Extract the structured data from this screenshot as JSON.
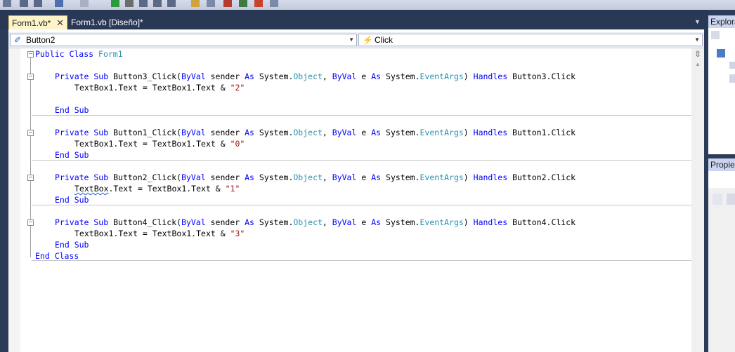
{
  "tabs": {
    "active": "Form1.vb*",
    "active_close": "✕",
    "second": "Form1.vb [Diseño]*",
    "dropdown": "▼"
  },
  "nav": {
    "object": "Button2",
    "event": "Click",
    "arrow": "▼"
  },
  "code": {
    "class_open": {
      "kw": "Public Class",
      "name": "Form1"
    },
    "class_close": "End Class",
    "sub_prefix": "Private Sub",
    "byval": "ByVal",
    "as": "As",
    "system": "System.",
    "object": "Object",
    "eventargs": "EventArgs",
    "handles": "Handles",
    "end_sub": "End Sub",
    "subs": [
      {
        "name": "Button3_Click",
        "handles": "Button3.Click",
        "body_a": "TextBox1",
        "body_b": ".Text = TextBox1.Text & ",
        "str": "\"2\""
      },
      {
        "name": "Button1_Click",
        "handles": "Button1.Click",
        "body_a": "TextBox1",
        "body_b": ".Text = TextBox1.Text & ",
        "str": "\"0\""
      },
      {
        "name": "Button2_Click",
        "handles": "Button2.Click",
        "body_a": "TextBox",
        "body_b": ".Text = TextBox1.Text & ",
        "str": "\"1\""
      },
      {
        "name": "Button4_Click",
        "handles": "Button4.Click",
        "body_a": "TextBox1",
        "body_b": ".Text = TextBox1.Text & ",
        "str": "\"3\""
      }
    ],
    "sender": "sender",
    "e": "e"
  },
  "panels": {
    "explorer": "Explorador",
    "properties": "Propiedades"
  },
  "colors": {
    "keyword": "#0000ff",
    "type": "#2b91af",
    "string": "#a31515",
    "tab_active": "#fff3c9",
    "chrome": "#293955"
  }
}
